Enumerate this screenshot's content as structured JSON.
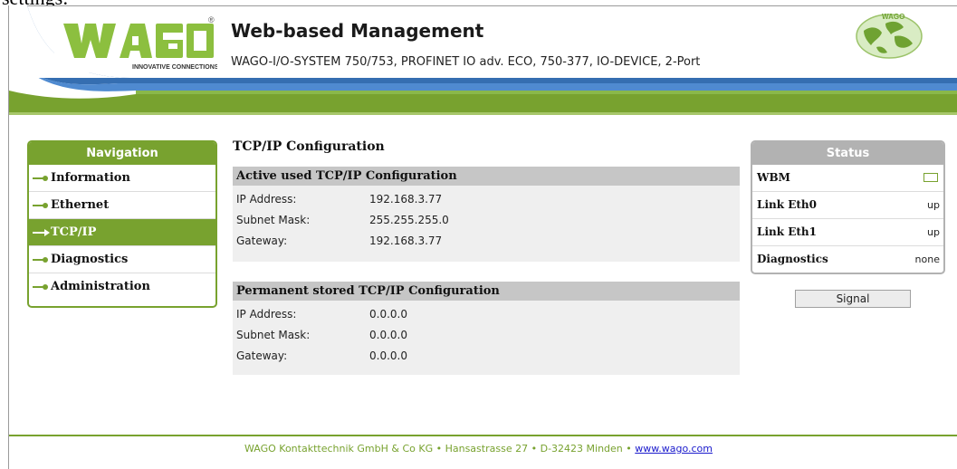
{
  "cut_text": "settings:",
  "header": {
    "title": "Web-based Management",
    "subtitle": "WAGO-I/O-SYSTEM 750/753, PROFINET IO adv. ECO, 750-377, IO-DEVICE, 2-Port",
    "logo_text": "WAGO",
    "logo_tagline": "INNOVATIVE CONNECTIONS",
    "globe_label": "WAGO"
  },
  "colors": {
    "accent_green": "#78a22f",
    "swoosh_blue": "#1f5ea8",
    "status_gray": "#b2b2b2"
  },
  "navigation": {
    "title": "Navigation",
    "items": [
      {
        "label": "Information",
        "active": false
      },
      {
        "label": "Ethernet",
        "active": false
      },
      {
        "label": "TCP/IP",
        "active": true
      },
      {
        "label": "Diagnostics",
        "active": false
      },
      {
        "label": "Administration",
        "active": false
      }
    ]
  },
  "main": {
    "title": "TCP/IP Configuration",
    "active_section": {
      "title": "Active used TCP/IP Configuration",
      "rows": [
        {
          "label": "IP Address:",
          "value": "192.168.3.77"
        },
        {
          "label": "Subnet Mask:",
          "value": "255.255.255.0"
        },
        {
          "label": "Gateway:",
          "value": "192.168.3.77"
        }
      ]
    },
    "stored_section": {
      "title": "Permanent stored TCP/IP Configuration",
      "rows": [
        {
          "label": "IP Address:",
          "value": "0.0.0.0"
        },
        {
          "label": "Subnet Mask:",
          "value": "0.0.0.0"
        },
        {
          "label": "Gateway:",
          "value": "0.0.0.0"
        }
      ]
    }
  },
  "status": {
    "title": "Status",
    "rows": [
      {
        "label": "WBM",
        "value": "",
        "icon": "led-indicator-icon"
      },
      {
        "label": "Link Eth0",
        "value": "up"
      },
      {
        "label": "Link Eth1",
        "value": "up"
      },
      {
        "label": "Diagnostics",
        "value": "none"
      }
    ],
    "signal_button": "Signal"
  },
  "footer": {
    "company": "WAGO Kontakttechnik GmbH & Co KG",
    "address": "Hansastrasse 27",
    "city": "D-32423 Minden",
    "separator": "•",
    "link": "www.wago.com"
  }
}
